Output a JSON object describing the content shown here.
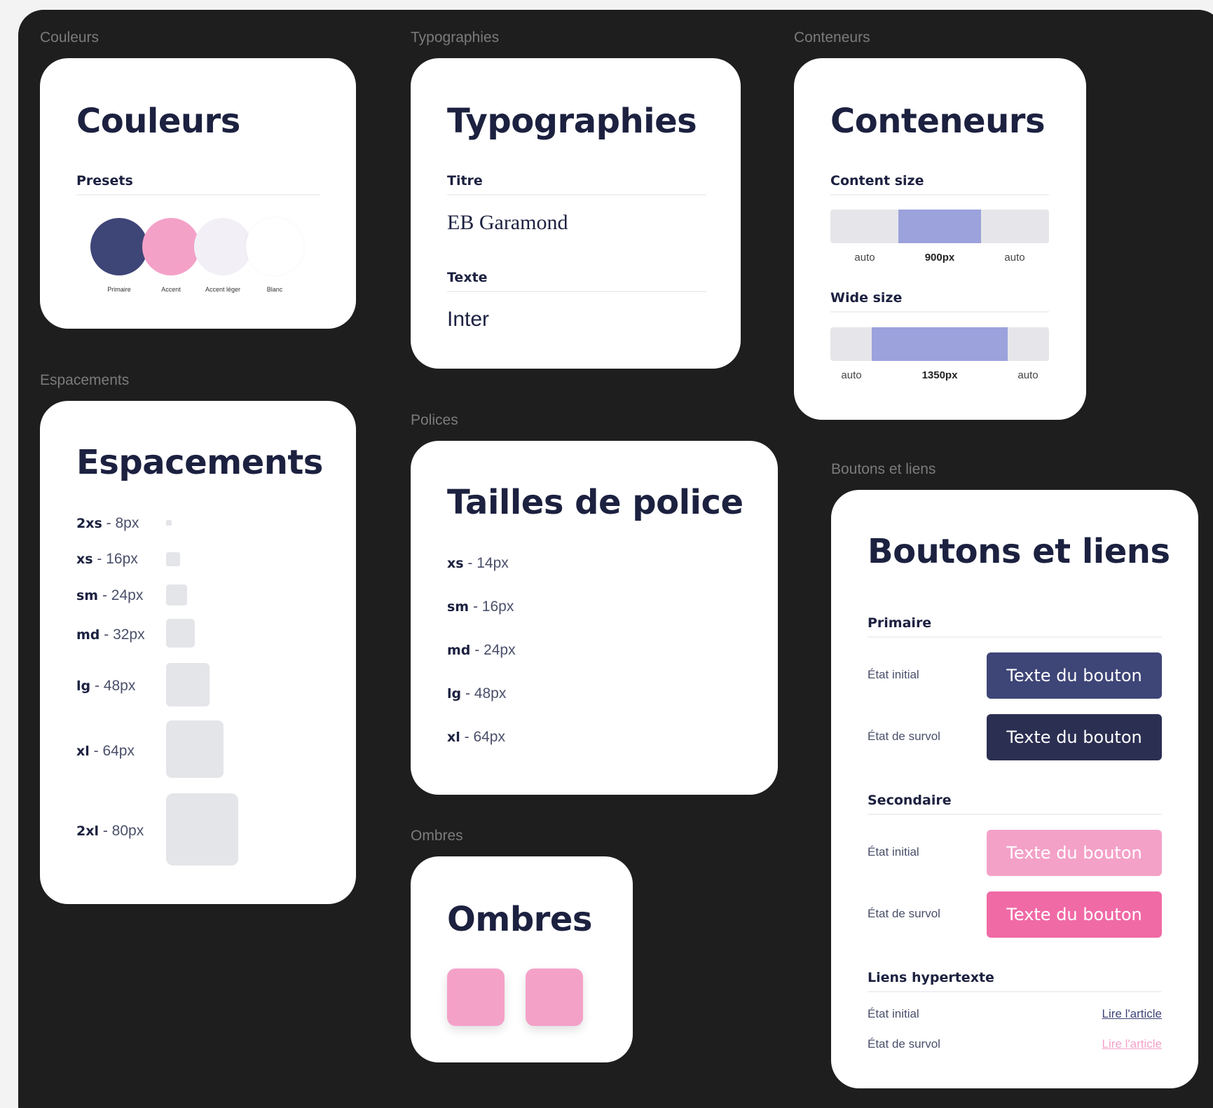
{
  "colors": {
    "primary": "#3e4577",
    "primary_hover": "#2b2f52",
    "accent": "#f4a1c8",
    "accent_hover": "#f06aa6",
    "accent_light": "#f2f0f6",
    "white": "#ffffff",
    "title": "#1c2140",
    "container_fill": "#9ba2dc"
  },
  "sections": {
    "couleurs": "Couleurs",
    "typographies": "Typographies",
    "conteneurs": "Conteneurs",
    "espacements": "Espacements",
    "polices": "Polices",
    "boutons": "Boutons et liens",
    "ombres": "Ombres"
  },
  "couleurs_card": {
    "title": "Couleurs",
    "presets_label": "Presets",
    "swatches": [
      {
        "label": "Primaire",
        "color": "#3e4577"
      },
      {
        "label": "Accent",
        "color": "#f4a1c8"
      },
      {
        "label": "Accent léger",
        "color": "#f2f0f6"
      },
      {
        "label": "Blanc",
        "color": "#ffffff"
      }
    ]
  },
  "typo_card": {
    "title": "Typographies",
    "titre_label": "Titre",
    "titre_font": "EB Garamond",
    "texte_label": "Texte",
    "texte_font": "Inter"
  },
  "conteneurs_card": {
    "title": "Conteneurs",
    "content_label": "Content size",
    "content_values": [
      "auto",
      "900px",
      "auto"
    ],
    "wide_label": "Wide size",
    "wide_values": [
      "auto",
      "1350px",
      "auto"
    ]
  },
  "espacements_card": {
    "title": "Espacements",
    "rows": [
      {
        "name": "2xs",
        "value": "8px"
      },
      {
        "name": "xs",
        "value": "16px"
      },
      {
        "name": "sm",
        "value": "24px"
      },
      {
        "name": "md",
        "value": "32px"
      },
      {
        "name": "lg",
        "value": "48px"
      },
      {
        "name": "xl",
        "value": "64px"
      },
      {
        "name": "2xl",
        "value": "80px"
      }
    ]
  },
  "polices_card": {
    "title": "Tailles de police",
    "rows": [
      {
        "name": "xs",
        "value": "14px"
      },
      {
        "name": "sm",
        "value": "16px"
      },
      {
        "name": "md",
        "value": "24px"
      },
      {
        "name": "lg",
        "value": "48px"
      },
      {
        "name": "xl",
        "value": "64px"
      }
    ]
  },
  "ombres_card": {
    "title": "Ombres"
  },
  "boutons_card": {
    "title": "Boutons et liens",
    "primaire_label": "Primaire",
    "secondaire_label": "Secondaire",
    "liens_label": "Liens hypertexte",
    "state_initial": "État initial",
    "state_hover": "État de survol",
    "button_text": "Texte du bouton",
    "link_text": "Lire l'article"
  }
}
